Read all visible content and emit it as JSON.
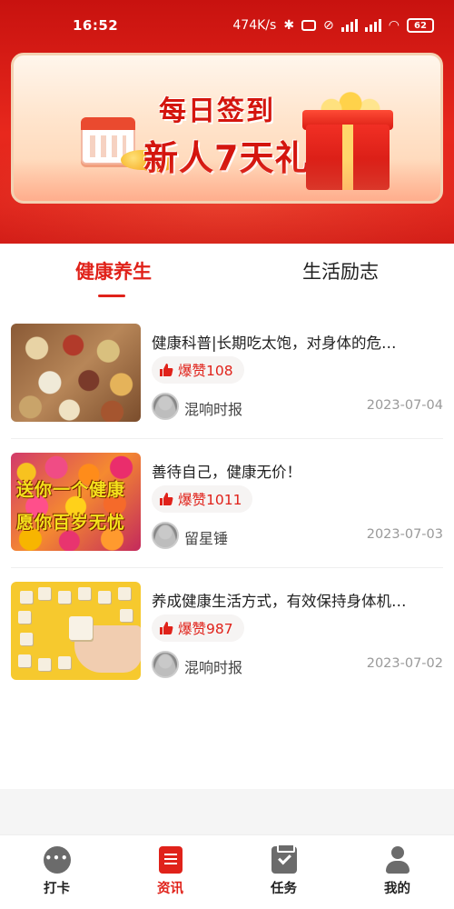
{
  "status_bar": {
    "time": "16:52",
    "network_speed": "474K/s",
    "battery": "62"
  },
  "banner": {
    "line1": "每日签到",
    "line2": "新人7天礼"
  },
  "tabs": [
    {
      "label": "健康养生",
      "active": true
    },
    {
      "label": "生活励志",
      "active": false
    }
  ],
  "articles": [
    {
      "title": "健康科普|长期吃太饱，对身体的危…",
      "likes": "爆赞108",
      "author": "混响时报",
      "date": "2023-07-04",
      "thumbnail": "spices-image"
    },
    {
      "title": "善待自己，健康无价！",
      "likes": "爆赞1011",
      "author": "留星锤",
      "date": "2023-07-03",
      "thumbnail": "flowers-image",
      "thumbnail_text": [
        "送你一个健康",
        "愿你百岁无忧"
      ]
    },
    {
      "title": "养成健康生活方式，有效保持身体机…",
      "likes": "爆赞987",
      "author": "混响时报",
      "date": "2023-07-02",
      "thumbnail": "cubes-image"
    }
  ],
  "bottom_nav": [
    {
      "label": "打卡",
      "icon": "chat-icon",
      "active": false
    },
    {
      "label": "资讯",
      "icon": "news-icon",
      "active": true
    },
    {
      "label": "任务",
      "icon": "task-icon",
      "active": false
    },
    {
      "label": "我的",
      "icon": "user-icon",
      "active": false
    }
  ],
  "colors": {
    "accent": "#e0221a",
    "header_red": "#d9201a"
  }
}
